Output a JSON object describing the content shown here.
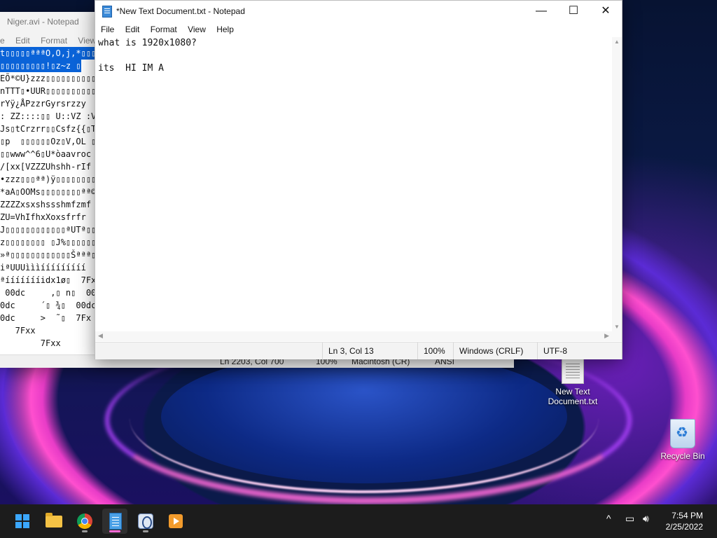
{
  "background_window": {
    "title": "Niger.avi - Notepad",
    "menu": [
      "e",
      "Edit",
      "Format",
      "View"
    ],
    "text_lines": [
      "t▯▯▯▯▯ªªªO,O,j,*▯▯▯",
      "▯▯▯▯▯▯▯▯▯!▯z~z ▯",
      "EÕ*©U}zzz▯▯▯▯▯▯▯▯▯▯Æª",
      "nTTT▯•UUR▯▯▯▯▯▯▯▯▯▯▯ª",
      "rYÿ¿ÅPzzrGyrsrzzy",
      ": ZZ::::▯▯ U::VZ :V",
      "Js▯tCrzrr▯▯Csfz{{▯T",
      "▯p  ▯▯▯▯▯▯Oz▯V,OL ▯ : :",
      "▯▯www^^6▯U*òaavroc",
      "/[xx[VZZZUhshh-rIf",
      "•zzz▯▯▯ªª)ÿ▯▯▯▯▯▯▯▯z~z",
      "*aA▯OOMs▯▯▯▯▯▯▯▯ªª©W",
      "ZZZZxsxshssshmfzmf",
      "ZU=VhIfhxXoxsfrfr",
      "J▯▯▯▯▯▯▯▯▯▯▯▯ªUTª▯▯▯▯▯",
      "z▯▯▯▯▯▯▯▯ ▯J%▯▯▯▯▯▯▯▯U*J",
      "»ª▯▯▯▯▯▯▯▯▯▯▯▯Šªªª▯▯",
      "iªUUUìììííííííííí",
      "ªíííííííidx1ø▯  7Fx",
      " 00dc     ,▯ n▯  00",
      "0dc     ´▯ ¾▯  00dc",
      "0dc     >  ˜▯  7Fx",
      "   7Fxx",
      "        7Fxx"
    ],
    "status": {
      "position": "Ln 2203, Col 700",
      "zoom": "100%",
      "line_ending": "Macintosh (CR)",
      "encoding": "ANSI"
    }
  },
  "foreground_window": {
    "title": "*New Text Document.txt - Notepad",
    "controls": {
      "minimize": "—",
      "maximize": "☐",
      "close": "✕"
    },
    "menu": [
      "File",
      "Edit",
      "Format",
      "View",
      "Help"
    ],
    "content": "what is 1920x1080?\n\nits  HI IM A",
    "status": {
      "position": "Ln 3, Col 13",
      "zoom": "100%",
      "line_ending": "Windows (CRLF)",
      "encoding": "UTF-8"
    }
  },
  "desktop_icons": [
    {
      "label": "New Text Document.txt",
      "icon": "text-file-icon"
    },
    {
      "label": "Recycle Bin",
      "icon": "recycle-bin-icon"
    }
  ],
  "taskbar": {
    "apps": [
      "start-icon",
      "file-explorer-icon",
      "chrome-icon",
      "notepad-icon",
      "hex-editor-icon",
      "media-player-icon"
    ],
    "tray": {
      "chevron": "^",
      "time": "7:54 PM",
      "date": "2/25/2022"
    }
  },
  "colors": {
    "selection": "#0a63d8",
    "taskbar": "#1c1c1c",
    "accent_underline": "#ff6ad9"
  }
}
